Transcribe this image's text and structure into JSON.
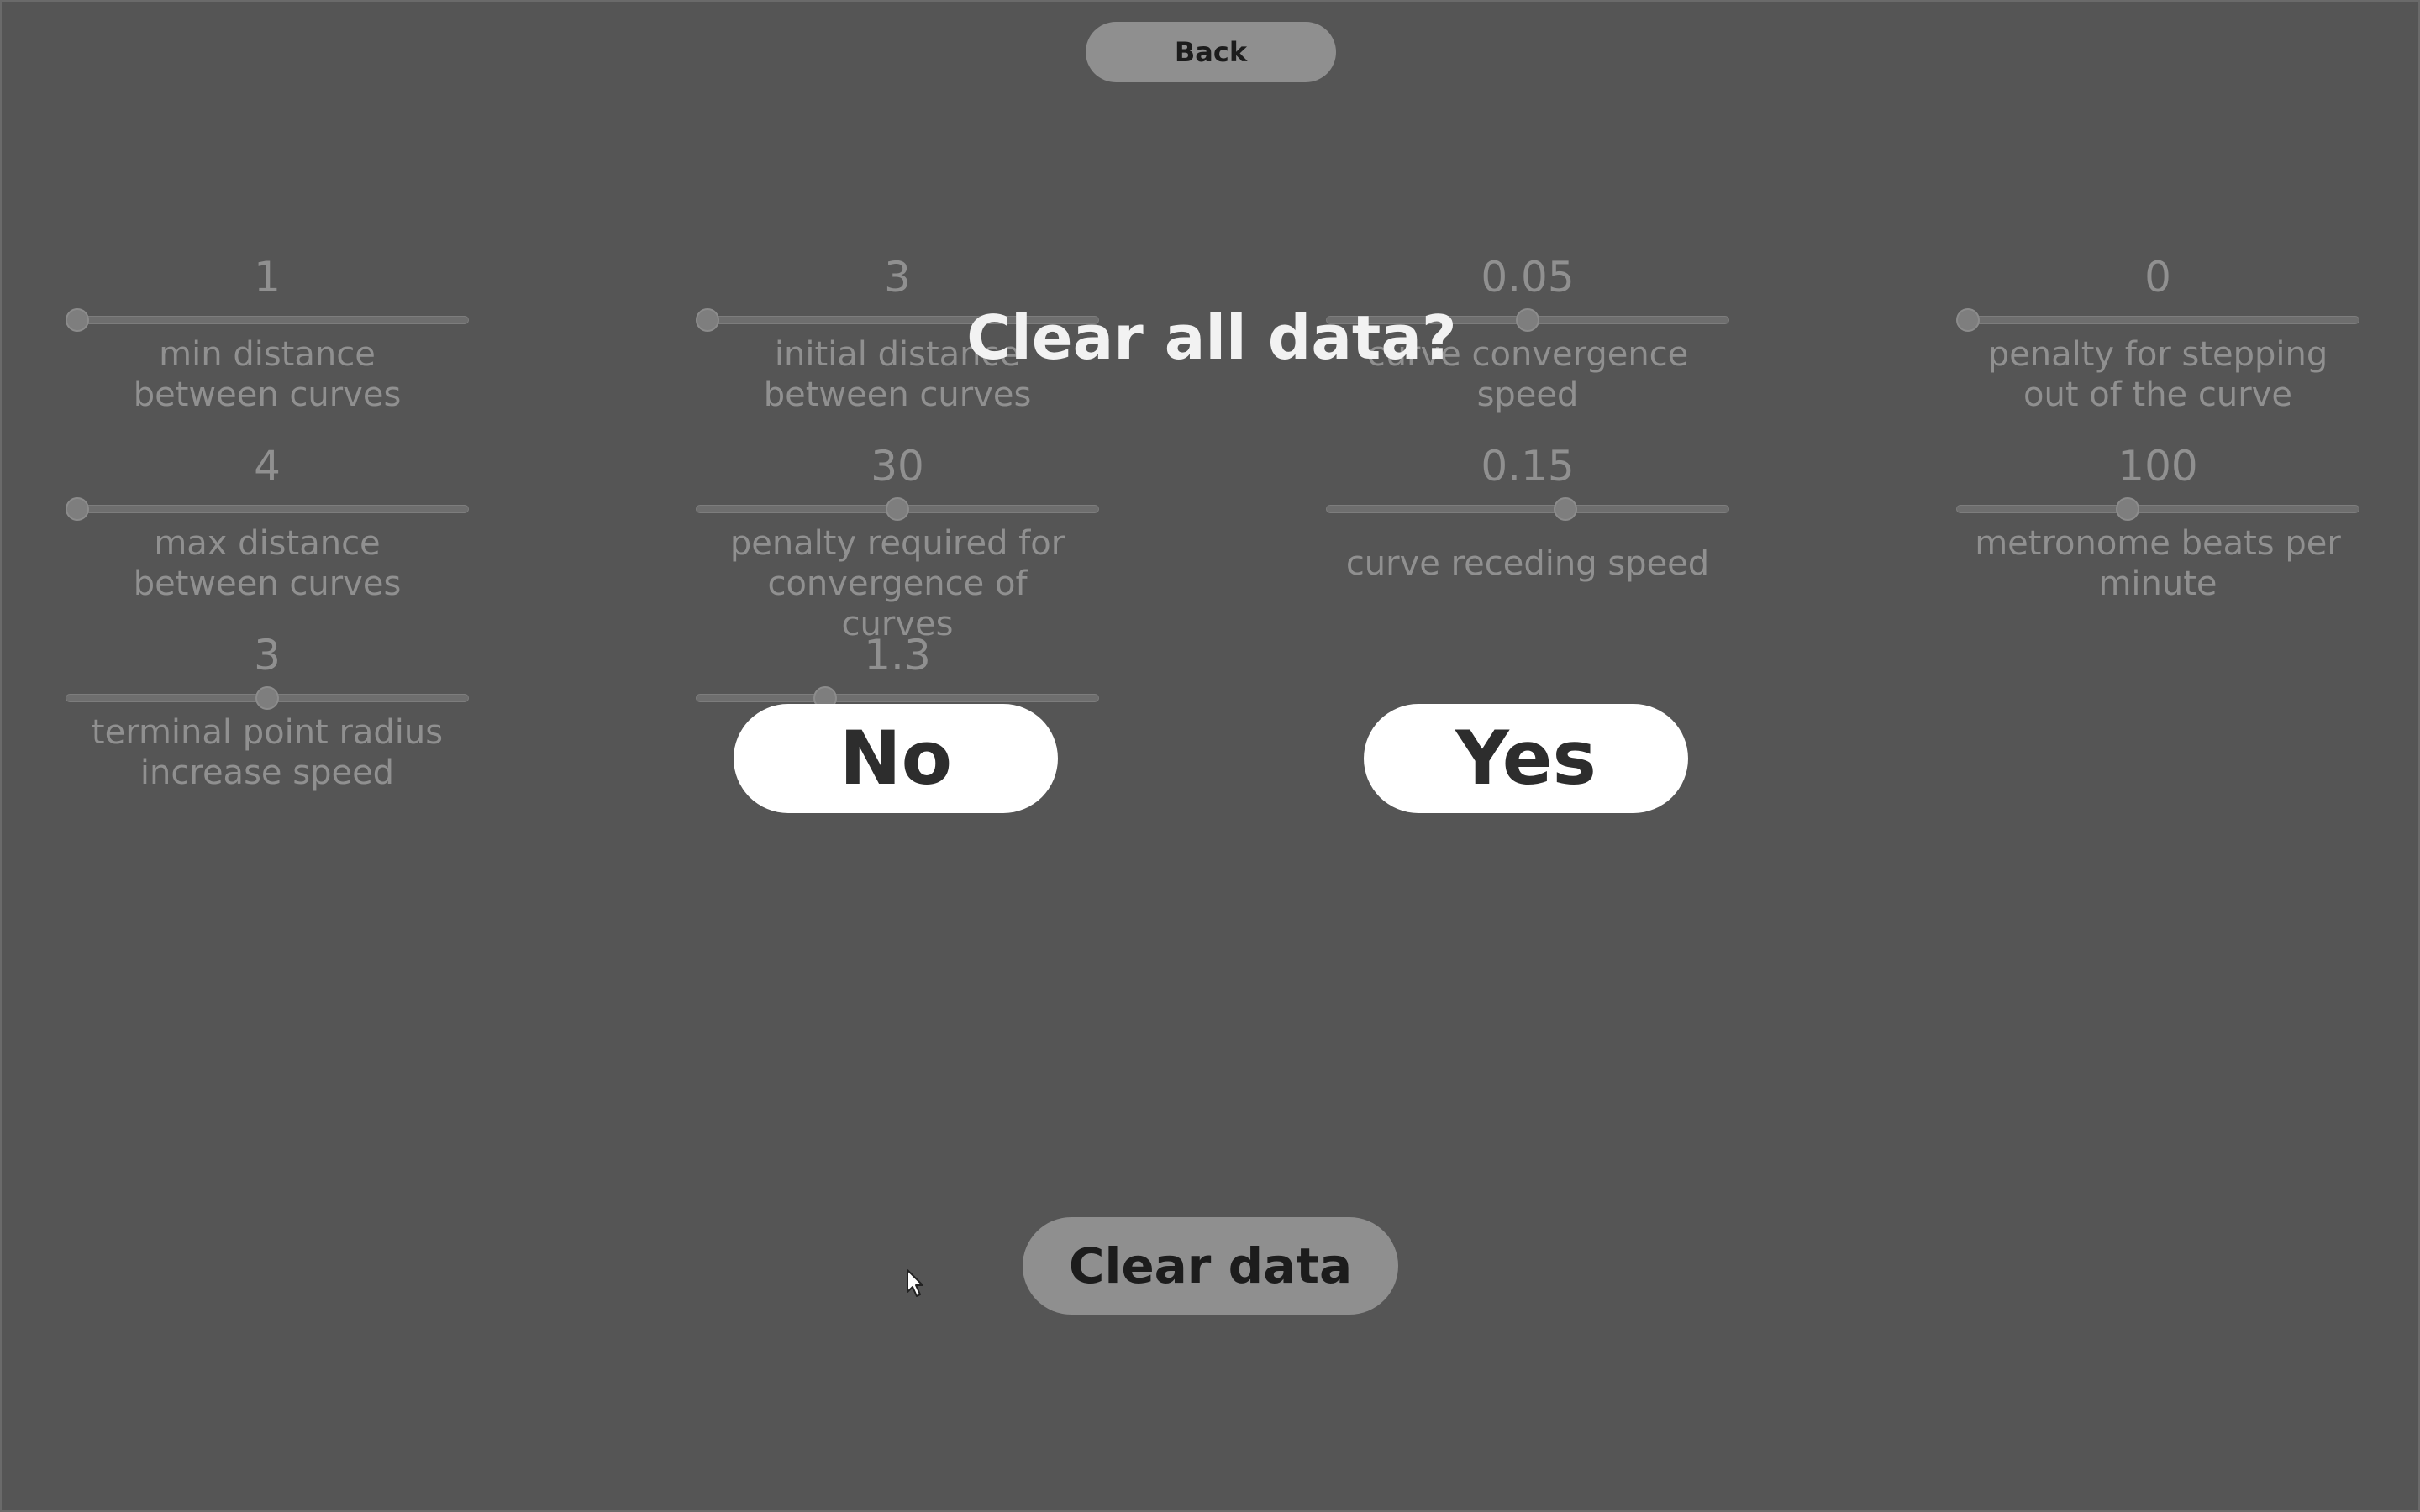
{
  "header": {
    "back_label": "Back"
  },
  "settings": [
    {
      "value": "1",
      "label": "min distance between curves",
      "fraction": 0.0
    },
    {
      "value": "3",
      "label": "initial distance between curves",
      "fraction": 0.0
    },
    {
      "value": "0.05",
      "label": "curve convergence speed",
      "fraction": 0.5
    },
    {
      "value": "0",
      "label": "penalty for stepping out of the curve",
      "fraction": 0.0
    },
    {
      "value": "4",
      "label": "max distance between curves",
      "fraction": 0.0
    },
    {
      "value": "30",
      "label": "penalty required for convergence of curves",
      "fraction": 0.5
    },
    {
      "value": "0.15",
      "label": "curve receding speed",
      "fraction": 0.6
    },
    {
      "value": "100",
      "label": "metronome beats per minute",
      "fraction": 0.42
    },
    {
      "value": "3",
      "label": "terminal point radius increase speed",
      "fraction": 0.5
    },
    {
      "value": "1.3",
      "label": "",
      "fraction": 0.31
    }
  ],
  "dialog": {
    "title": "Clear all data?",
    "no_label": "No",
    "yes_label": "Yes"
  },
  "footer": {
    "clear_label": "Clear data"
  },
  "icons": {
    "cursor": "mouse-pointer-icon"
  },
  "colors": {
    "background": "#555555",
    "button_gray": "#8f8f8f",
    "dialog_button": "#ffffff",
    "dialog_title": "#f2f2f2"
  }
}
